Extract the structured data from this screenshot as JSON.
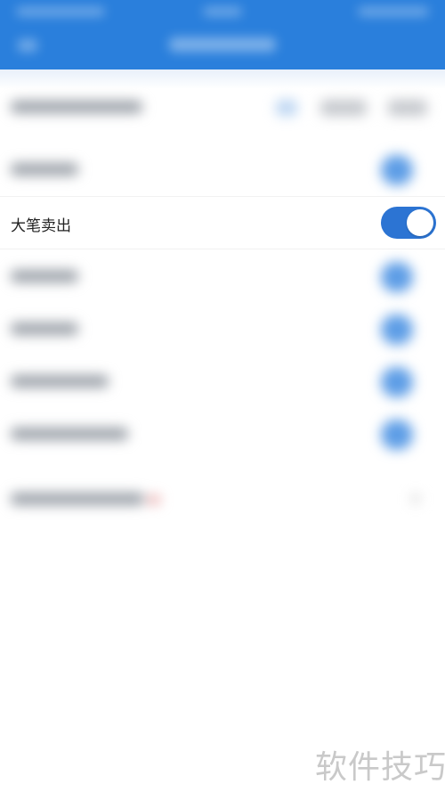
{
  "setting": {
    "label": "大笔卖出",
    "enabled": true
  },
  "colors": {
    "header": "#2a7fdc",
    "toggle_on": "#2c74d3",
    "text": "#222222",
    "watermark": "#c9c9c9"
  },
  "watermark": {
    "text": "软件技巧"
  }
}
